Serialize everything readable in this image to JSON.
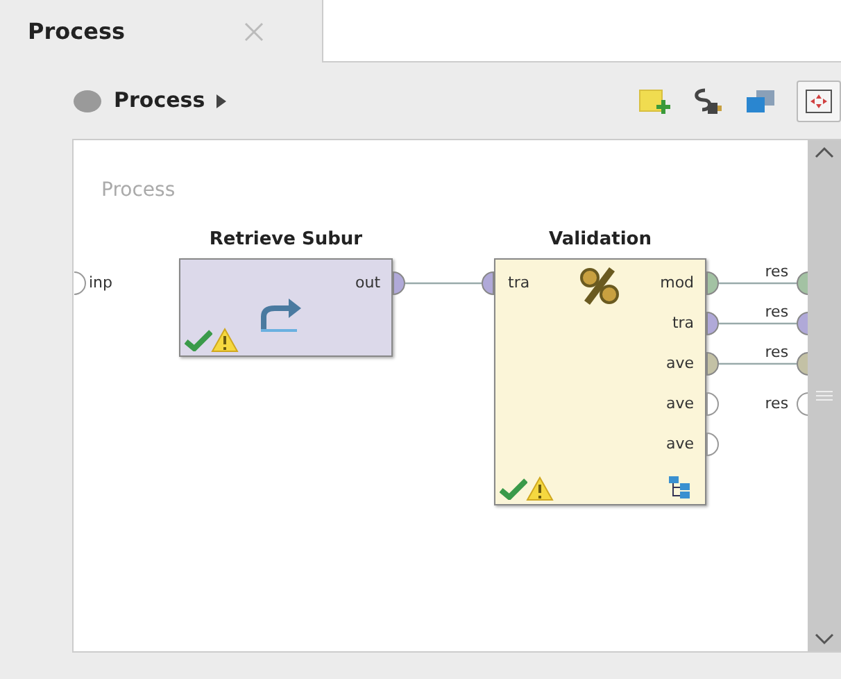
{
  "tabs": [
    {
      "label": "Process",
      "selected": true
    }
  ],
  "breadcrumb": {
    "label": "Process"
  },
  "canvas": {
    "title": "Process",
    "input_ports": [
      {
        "label": "inp"
      }
    ],
    "operators": [
      {
        "title": "Retrieve Subur",
        "ok": true,
        "warning": true,
        "subprocess": false,
        "outputs": [
          {
            "label": "out",
            "color": "#b0a9d8",
            "connected": true
          }
        ]
      },
      {
        "title": "Validation",
        "ok": true,
        "warning": true,
        "subprocess": true,
        "inputs": [
          {
            "label": "tra",
            "color": "#b0a9d8",
            "connected": true
          }
        ],
        "outputs": [
          {
            "label": "mod",
            "color": "#a3c2a3",
            "connected": true
          },
          {
            "label": "tra",
            "color": "#b0a9d8",
            "connected": true
          },
          {
            "label": "ave",
            "color": "#c3c1a5",
            "connected": true
          },
          {
            "label": "ave",
            "connected": false
          },
          {
            "label": "ave",
            "connected": false
          }
        ]
      }
    ],
    "result_ports": [
      {
        "label": "res",
        "color": "#a3c2a3",
        "connected": true
      },
      {
        "label": "res",
        "color": "#b0a9d8",
        "connected": true
      },
      {
        "label": "res",
        "color": "#c3c1a5",
        "connected": true
      },
      {
        "label": "res",
        "connected": false
      }
    ]
  }
}
